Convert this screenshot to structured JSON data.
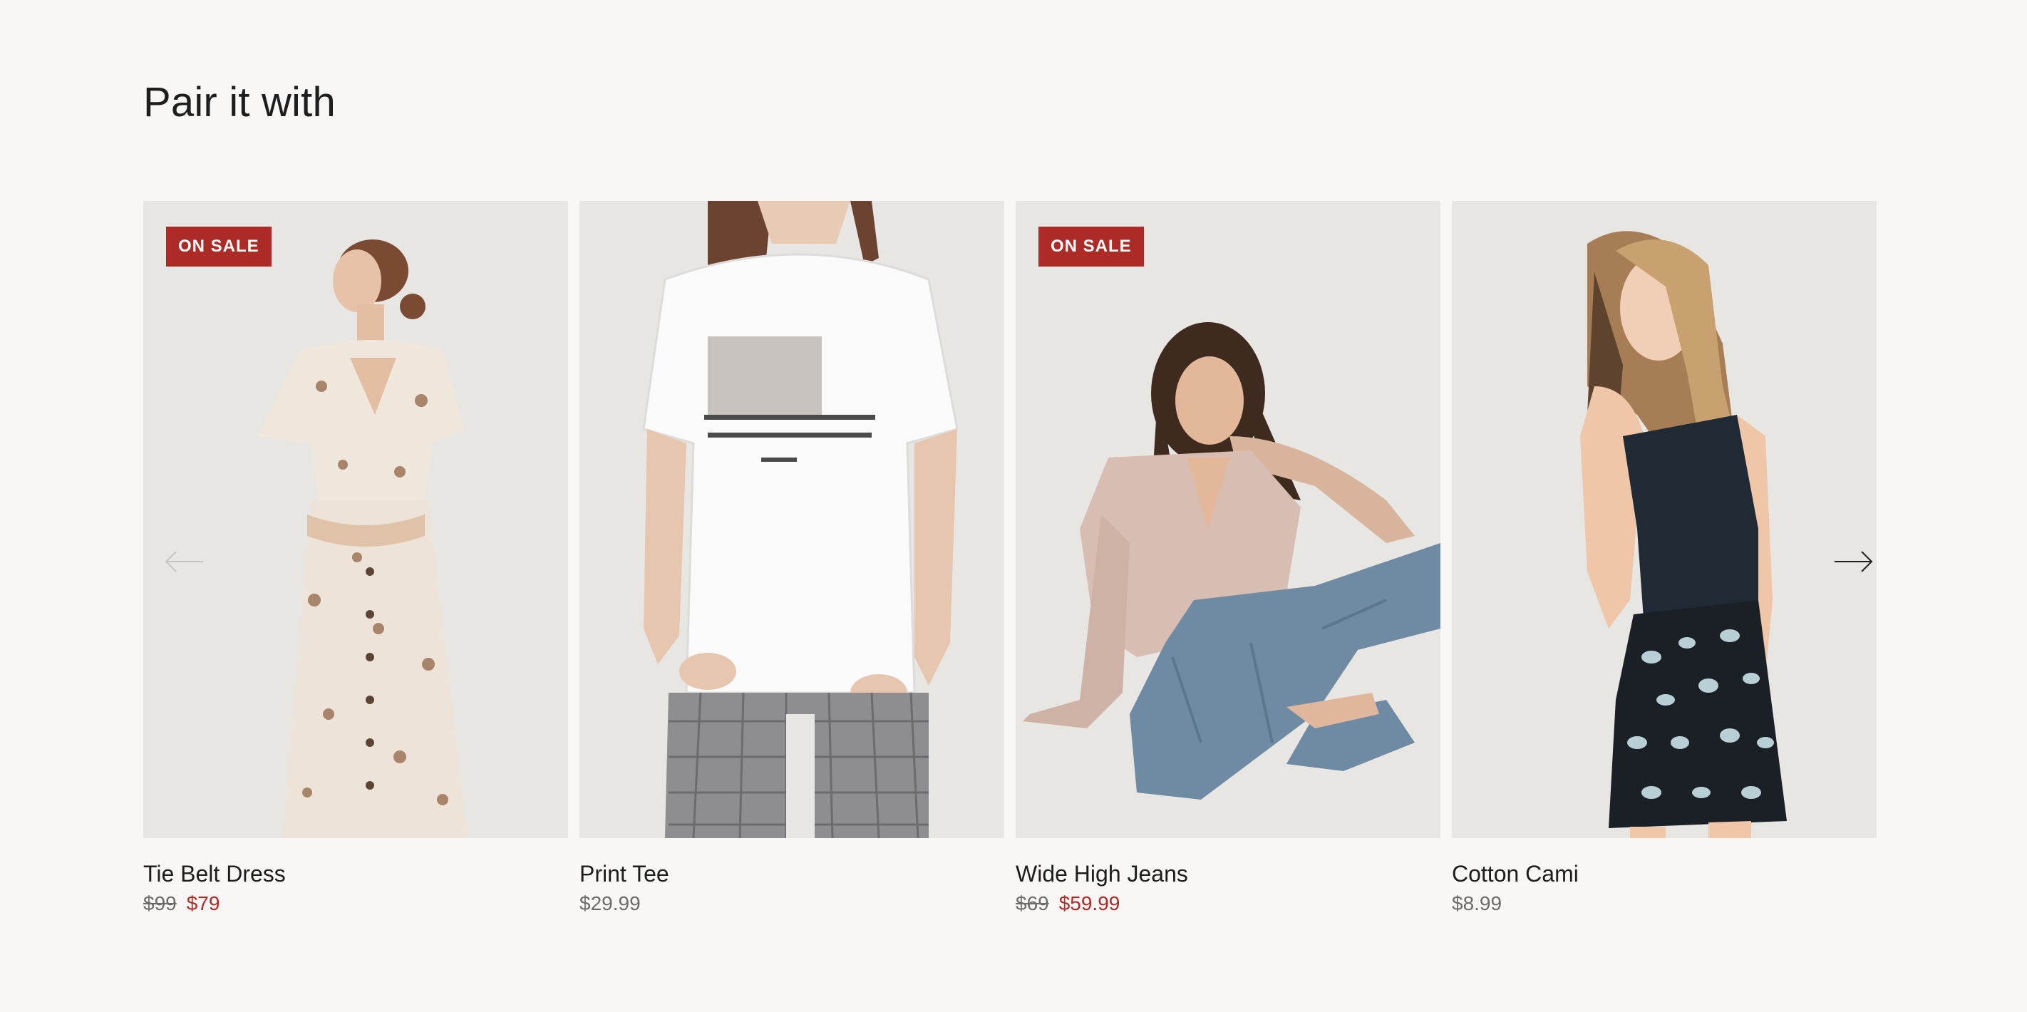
{
  "section": {
    "title": "Pair it with"
  },
  "products": [
    {
      "name": "Tie Belt Dress",
      "badge": "ON SALE",
      "price_original": "$99",
      "price_sale": "$79",
      "image_icon": "floral-dress-model-image"
    },
    {
      "name": "Print Tee",
      "badge": "",
      "price": "$29.99",
      "image_icon": "white-tee-model-image"
    },
    {
      "name": "Wide High Jeans",
      "badge": "ON SALE",
      "price_original": "$69",
      "price_sale": "$59.99",
      "image_icon": "jeans-model-image"
    },
    {
      "name": "Cotton Cami",
      "badge": "",
      "price": "$8.99",
      "image_icon": "cami-model-image"
    }
  ],
  "controls": {
    "prev_icon": "arrow-left-icon",
    "next_icon": "arrow-right-icon"
  },
  "colors": {
    "background": "#f8f7f5",
    "image_background": "#e8e6e3",
    "sale_accent": "#ad2b27",
    "text_primary": "#1d1d1d",
    "text_muted": "#6b6b6b"
  }
}
